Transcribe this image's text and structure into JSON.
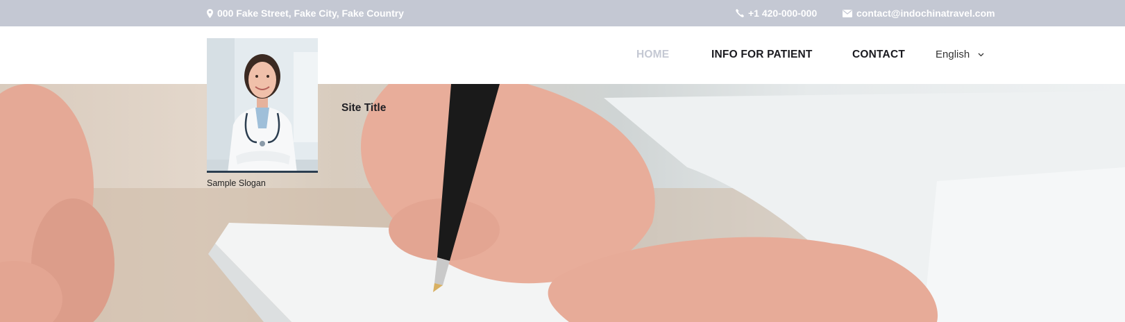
{
  "topbar": {
    "address": "000 Fake Street, Fake City, Fake Country",
    "phone": "+1 420-000-000",
    "email": "contact@indochinatravel.com",
    "icons": {
      "address": "map-marker-icon",
      "phone": "phone-icon",
      "email": "envelope-icon"
    },
    "background": "#c4c8d3",
    "text_color": "#ffffff"
  },
  "nav": {
    "items": [
      {
        "label": "HOME",
        "active": true
      },
      {
        "label": "INFO FOR PATIENT",
        "active": false
      },
      {
        "label": "CONTACT",
        "active": false
      }
    ],
    "language": {
      "selected": "English",
      "icon": "chevron-down-icon"
    },
    "active_color": "#c4c8d3",
    "text_color": "#1a1a1f"
  },
  "brand": {
    "site_title": "Site Title",
    "slogan": "Sample Slogan",
    "logo_image": "doctor-portrait"
  },
  "hero": {
    "image": "doctor-hand-writing-with-fountain-pen"
  }
}
